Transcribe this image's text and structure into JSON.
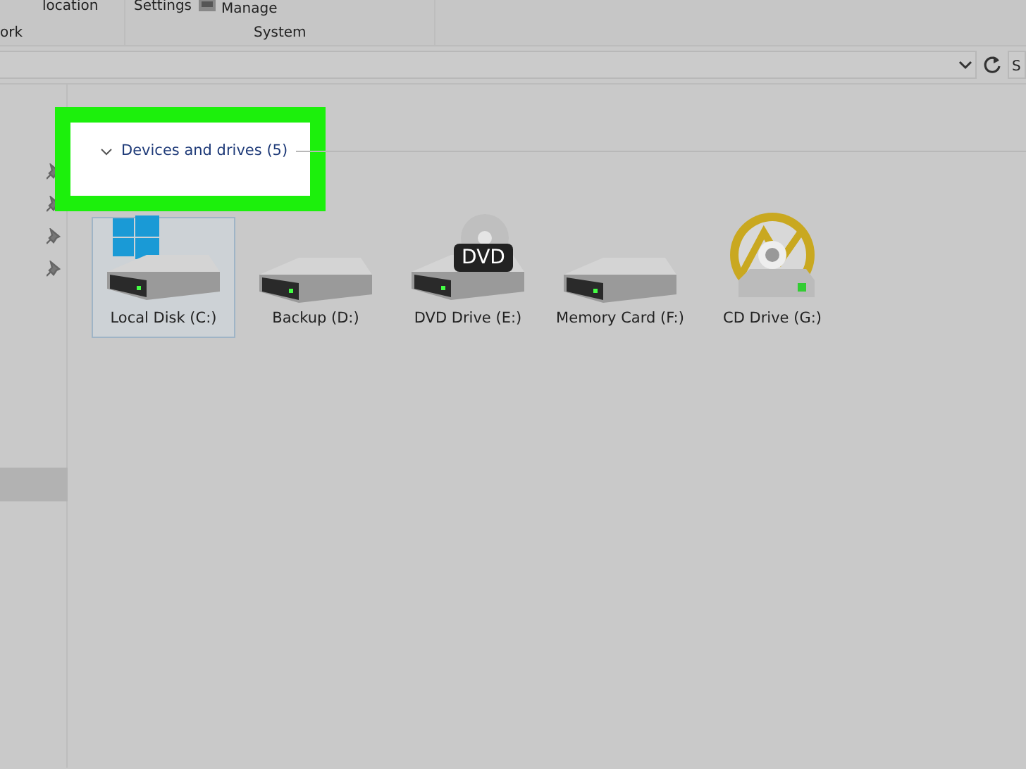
{
  "ribbon": {
    "commands": [
      {
        "label": "location"
      },
      {
        "label": "Settings"
      },
      {
        "label": "Manage"
      }
    ],
    "groups": [
      {
        "label": "ork"
      },
      {
        "label": "System"
      }
    ]
  },
  "address_bar": {
    "search_placeholder": "S"
  },
  "navigation": {
    "items": [
      {
        "selected": true
      }
    ]
  },
  "section": {
    "title": "Devices and drives (5)",
    "expanded": true,
    "highlighted": true
  },
  "drives": [
    {
      "kind": "system",
      "label": "Local Disk (C:)",
      "selected": true
    },
    {
      "kind": "disk",
      "label": "Backup (D:)",
      "selected": false
    },
    {
      "kind": "dvd",
      "label": "DVD Drive (E:)",
      "selected": false,
      "badge": "DVD"
    },
    {
      "kind": "disk",
      "label": "Memory Card (F:)",
      "selected": false
    },
    {
      "kind": "cd",
      "label": "CD Drive (G:)",
      "selected": false
    }
  ]
}
